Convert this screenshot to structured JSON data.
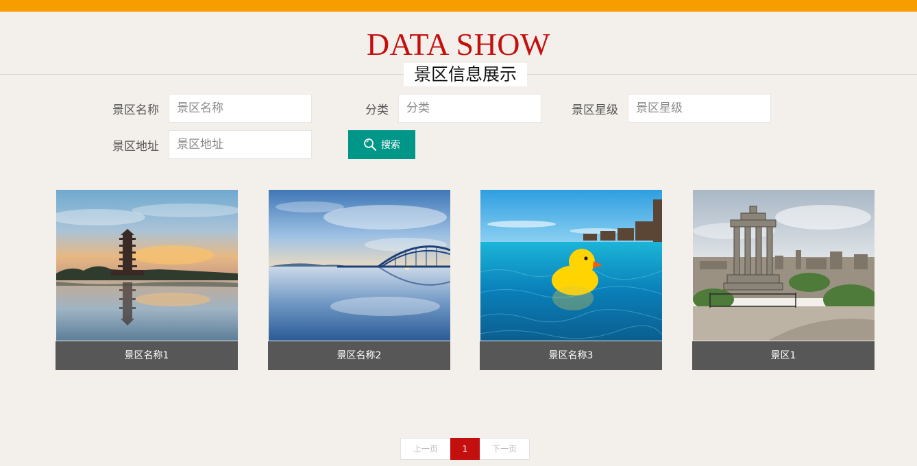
{
  "header": {
    "title": "DATA SHOW",
    "subtitle": "景区信息展示"
  },
  "search": {
    "fields": [
      {
        "label": "景区名称",
        "placeholder": "景区名称"
      },
      {
        "label": "分类",
        "placeholder": "分类"
      },
      {
        "label": "景区星级",
        "placeholder": "景区星级"
      },
      {
        "label": "景区地址",
        "placeholder": "景区地址"
      }
    ],
    "button_label": "搜索"
  },
  "cards": [
    {
      "title": "景区名称1"
    },
    {
      "title": "景区名称2"
    },
    {
      "title": "景区名称3"
    },
    {
      "title": "景区1"
    }
  ],
  "pagination": {
    "prev": "上一页",
    "current": "1",
    "next": "下一页"
  },
  "colors": {
    "top_bar": "#f89d00",
    "title": "#c40f0f",
    "button": "#009688",
    "caption_bg": "#575757",
    "page_bg": "#f3efea"
  }
}
